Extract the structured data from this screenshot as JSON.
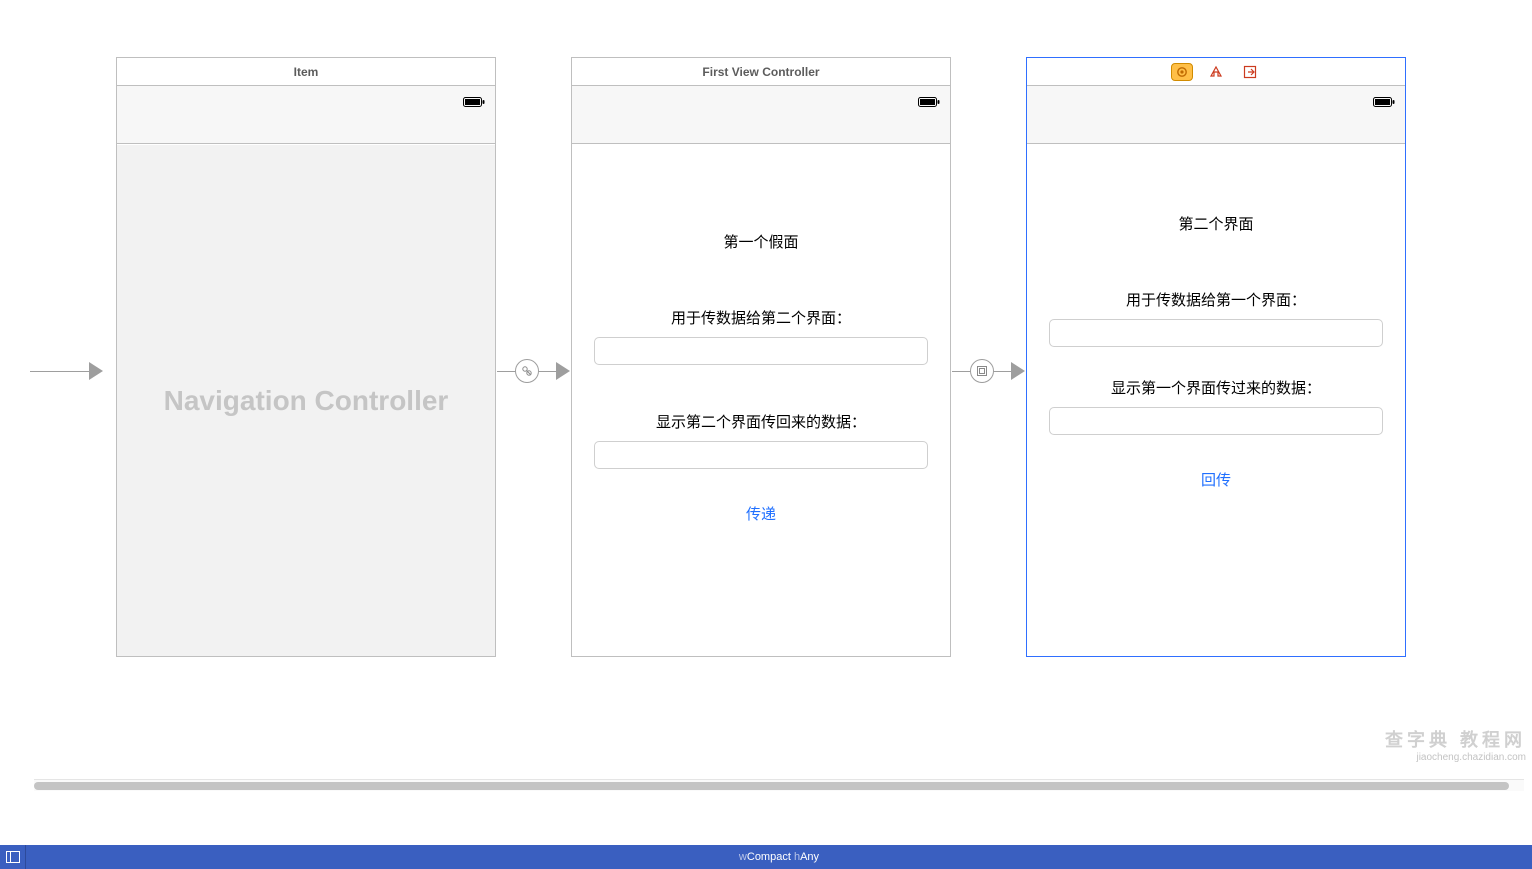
{
  "scene1": {
    "title": "Item",
    "placeholder": "Navigation Controller"
  },
  "scene2": {
    "title": "First View Controller",
    "heading": "第一个假面",
    "label_pass": "用于传数据给第二个界面：",
    "label_show": "显示第二个界面传回来的数据：",
    "button": "传递"
  },
  "scene3": {
    "heading": "第二个界面",
    "label_pass": "用于传数据给第一个界面：",
    "label_show": "显示第一个界面传过来的数据：",
    "button": "回传"
  },
  "footer": {
    "w_prefix": "w",
    "w_value": "Compact",
    "h_prefix": "h",
    "h_value": "Any"
  },
  "watermark": {
    "line1": "查字典 教程网",
    "line2": "jiaocheng.chazidian.com"
  }
}
